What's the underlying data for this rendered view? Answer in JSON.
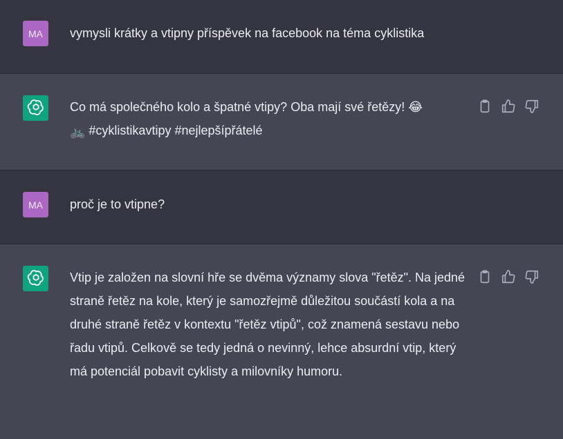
{
  "conversation": [
    {
      "role": "user",
      "avatar": "MA",
      "text": "vymysli krátky a vtipny příspěvek na facebook na téma cyklistika"
    },
    {
      "role": "assistant",
      "avatar_icon": "openai-logo-icon",
      "text_line1": "Co má společného kolo a špatné vtipy? Oba mají své řetězy! 😂",
      "text_line2_emoji": "🚲",
      "text_line2": " #cyklistikavtipy #nejlepšípřátelé",
      "action_icons": [
        "clipboard-icon",
        "thumbs-up-icon",
        "thumbs-down-icon"
      ]
    },
    {
      "role": "user",
      "avatar": "MA",
      "text": "proč je to vtipne?"
    },
    {
      "role": "assistant",
      "avatar_icon": "openai-logo-icon",
      "text": "Vtip je založen na slovní hře se dvěma významy slova \"řetěz\". Na jedné straně řetěz na kole, který je samozřejmě důležitou součástí kola a na druhé straně řetěz v kontextu \"řetěz vtipů\", což znamená sestavu nebo řadu vtipů. Celkově se tedy jedná o nevinný, lehce absurdní vtip, který má potenciál pobavit cyklisty a milovníky humoru.",
      "action_icons": [
        "clipboard-icon",
        "thumbs-up-icon",
        "thumbs-down-icon"
      ]
    }
  ],
  "colors": {
    "user_bg": "#343541",
    "assistant_bg": "#444654",
    "user_avatar": "#ab68c2",
    "bot_avatar": "#10a37f",
    "text": "#ececf1",
    "icon": "#acacbe"
  }
}
